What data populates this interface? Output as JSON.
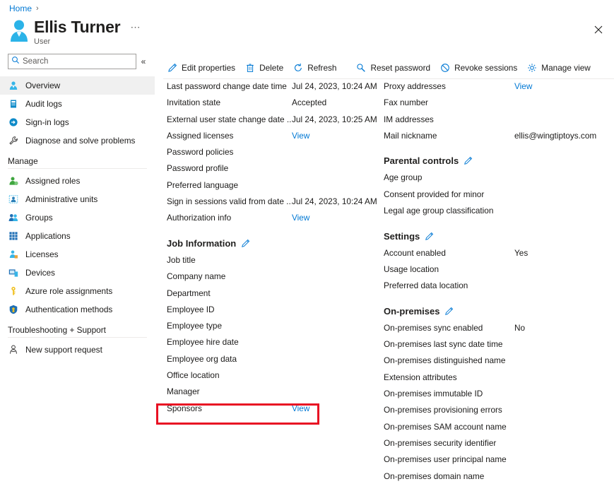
{
  "breadcrumb": {
    "home": "Home",
    "separator": "›"
  },
  "header": {
    "title": "Ellis Turner",
    "subtitle": "User",
    "more_label": "⋯",
    "close_icon": "close-icon"
  },
  "sidebar": {
    "search": {
      "placeholder": "Search",
      "value": ""
    },
    "collapse_label": "«",
    "items": [
      {
        "label": "Overview",
        "icon": "user-icon",
        "selected": true
      },
      {
        "label": "Audit logs",
        "icon": "audit-log-icon",
        "selected": false
      },
      {
        "label": "Sign-in logs",
        "icon": "sign-in-icon",
        "selected": false
      },
      {
        "label": "Diagnose and solve problems",
        "icon": "wrench-icon",
        "selected": false
      }
    ],
    "manage_group": {
      "label": "Manage",
      "items": [
        {
          "label": "Assigned roles",
          "icon": "assigned-roles-icon"
        },
        {
          "label": "Administrative units",
          "icon": "administrative-units-icon"
        },
        {
          "label": "Groups",
          "icon": "groups-icon"
        },
        {
          "label": "Applications",
          "icon": "applications-grid-icon"
        },
        {
          "label": "Licenses",
          "icon": "licenses-icon"
        },
        {
          "label": "Devices",
          "icon": "devices-icon"
        },
        {
          "label": "Azure role assignments",
          "icon": "key-icon"
        },
        {
          "label": "Authentication methods",
          "icon": "shield-icon"
        }
      ]
    },
    "troubleshoot_group": {
      "label": "Troubleshooting + Support",
      "items": [
        {
          "label": "New support request",
          "icon": "support-person-icon"
        }
      ]
    }
  },
  "toolbar": {
    "buttons": [
      {
        "label": "Edit properties",
        "icon": "pencil-icon"
      },
      {
        "label": "Delete",
        "icon": "trash-icon"
      },
      {
        "label": "Refresh",
        "icon": "refresh-icon"
      }
    ],
    "buttons2": [
      {
        "label": "Reset password",
        "icon": "key-search-icon"
      },
      {
        "label": "Revoke sessions",
        "icon": "revoke-icon"
      },
      {
        "label": "Manage view",
        "icon": "gear-icon"
      }
    ],
    "overflow_label": "⋯"
  },
  "left_column": {
    "rows_top": [
      {
        "label": "Last password change date time",
        "value": "Jul 24, 2023, 10:24 AM",
        "is_link": false
      },
      {
        "label": "Invitation state",
        "value": "Accepted",
        "is_link": false
      },
      {
        "label": "External user state change date ...",
        "value": "Jul 24, 2023, 10:25 AM",
        "is_link": false
      },
      {
        "label": "Assigned licenses",
        "value": "View",
        "is_link": true
      },
      {
        "label": "Password policies",
        "value": "",
        "is_link": false
      },
      {
        "label": "Password profile",
        "value": "",
        "is_link": false
      },
      {
        "label": "Preferred language",
        "value": "",
        "is_link": false
      },
      {
        "label": "Sign in sessions valid from date ...",
        "value": "Jul 24, 2023, 10:24 AM",
        "is_link": false
      },
      {
        "label": "Authorization info",
        "value": "View",
        "is_link": true
      }
    ],
    "job_information": {
      "heading": "Job Information",
      "edit_icon": "pencil-icon",
      "rows": [
        {
          "label": "Job title",
          "value": "",
          "is_link": false
        },
        {
          "label": "Company name",
          "value": "",
          "is_link": false
        },
        {
          "label": "Department",
          "value": "",
          "is_link": false
        },
        {
          "label": "Employee ID",
          "value": "",
          "is_link": false
        },
        {
          "label": "Employee type",
          "value": "",
          "is_link": false
        },
        {
          "label": "Employee hire date",
          "value": "",
          "is_link": false
        },
        {
          "label": "Employee org data",
          "value": "",
          "is_link": false
        },
        {
          "label": "Office location",
          "value": "",
          "is_link": false
        },
        {
          "label": "Manager",
          "value": "",
          "is_link": false
        },
        {
          "label": "Sponsors",
          "value": "View",
          "is_link": true,
          "highlighted": true
        }
      ]
    }
  },
  "right_column": {
    "rows_top": [
      {
        "label": "Proxy addresses",
        "value": "View",
        "is_link": true
      },
      {
        "label": "Fax number",
        "value": "",
        "is_link": false
      },
      {
        "label": "IM addresses",
        "value": "",
        "is_link": false
      },
      {
        "label": "Mail nickname",
        "value": "ellis@wingtiptoys.com",
        "is_link": false
      }
    ],
    "parental_controls": {
      "heading": "Parental controls",
      "edit_icon": "pencil-icon",
      "rows": [
        {
          "label": "Age group",
          "value": "",
          "is_link": false
        },
        {
          "label": "Consent provided for minor",
          "value": "",
          "is_link": false
        },
        {
          "label": "Legal age group classification",
          "value": "",
          "is_link": false
        }
      ]
    },
    "settings": {
      "heading": "Settings",
      "edit_icon": "pencil-icon",
      "rows": [
        {
          "label": "Account enabled",
          "value": "Yes",
          "is_link": false
        },
        {
          "label": "Usage location",
          "value": "",
          "is_link": false
        },
        {
          "label": "Preferred data location",
          "value": "",
          "is_link": false
        }
      ]
    },
    "on_premises": {
      "heading": "On-premises",
      "edit_icon": "pencil-icon",
      "rows": [
        {
          "label": "On-premises sync enabled",
          "value": "No",
          "is_link": false
        },
        {
          "label": "On-premises last sync date time",
          "value": "",
          "is_link": false
        },
        {
          "label": "On-premises distinguished name",
          "value": "",
          "is_link": false
        },
        {
          "label": "Extension attributes",
          "value": "",
          "is_link": false
        },
        {
          "label": "On-premises immutable ID",
          "value": "",
          "is_link": false
        },
        {
          "label": "On-premises provisioning errors",
          "value": "",
          "is_link": false
        },
        {
          "label": "On-premises SAM account name",
          "value": "",
          "is_link": false
        },
        {
          "label": "On-premises security identifier",
          "value": "",
          "is_link": false
        },
        {
          "label": "On-premises user principal name",
          "value": "",
          "is_link": false
        },
        {
          "label": "On-premises domain name",
          "value": "",
          "is_link": false
        }
      ]
    }
  },
  "colors": {
    "link": "#0078d4",
    "accent": "#0078d4",
    "highlight_border": "#e81123",
    "selected_nav_bg": "#f0f0f0",
    "text": "#1b1a19"
  }
}
